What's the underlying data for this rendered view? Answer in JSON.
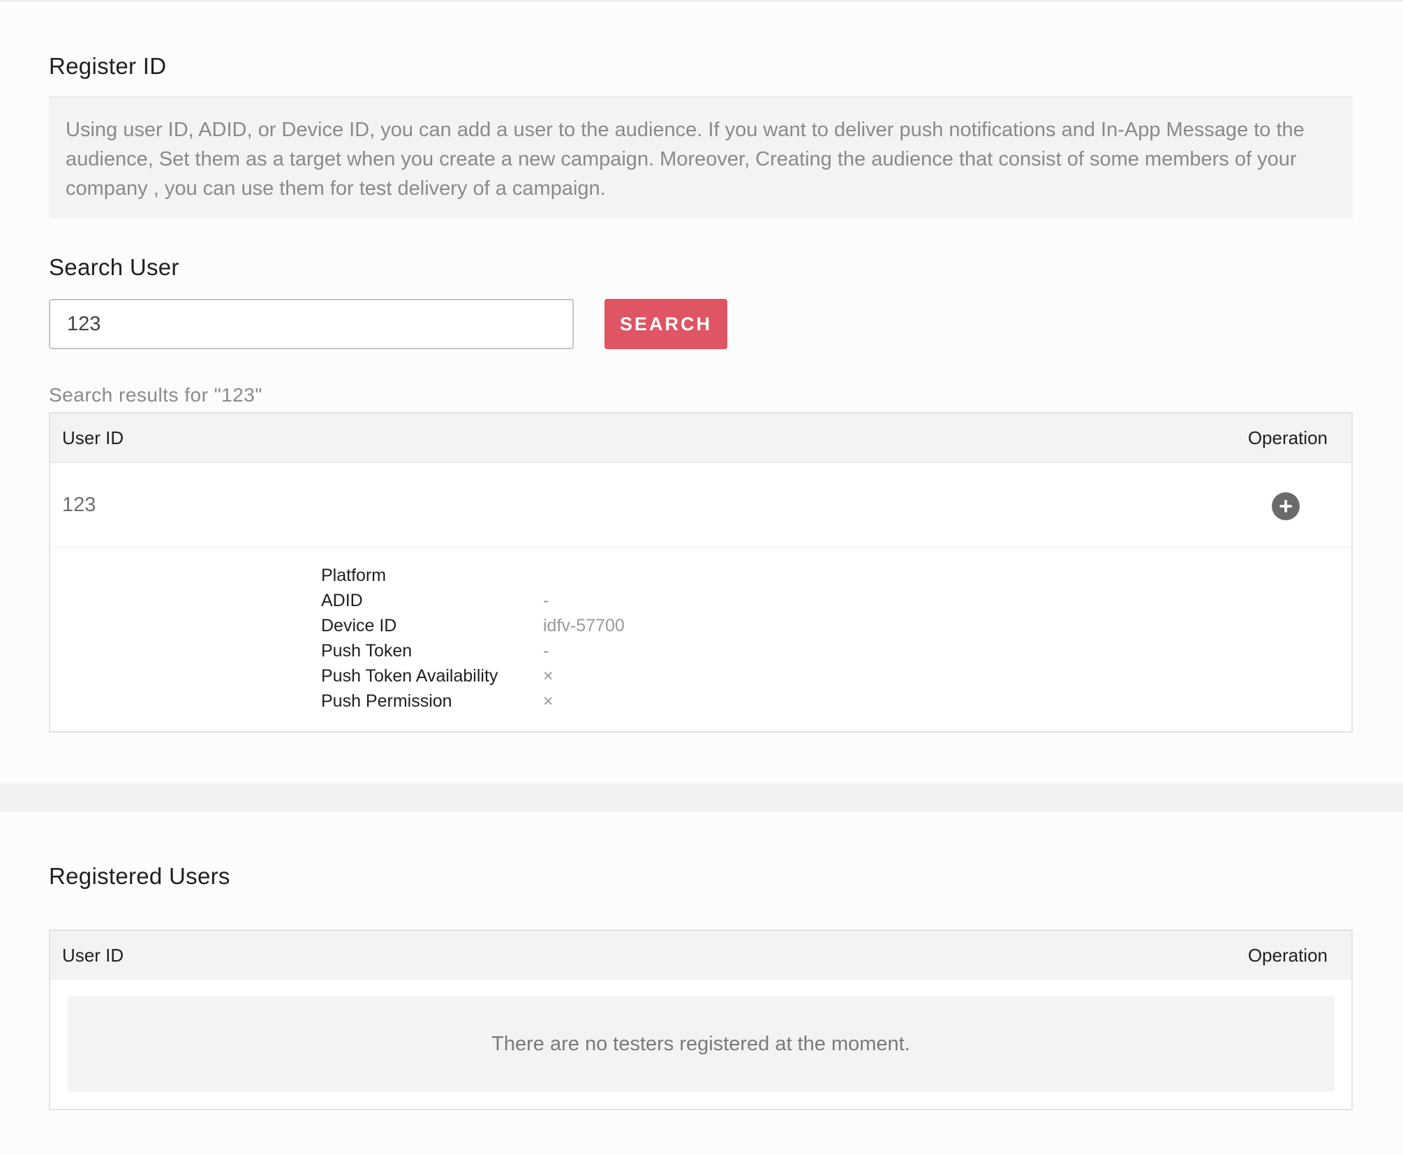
{
  "register": {
    "title": "Register ID",
    "description": "Using user ID, ADID, or Device ID, you can add a user to the audience. If you want to deliver push notifications and In-App Message to the audience, Set them as a target when you create a new campaign. Moreover, Creating the audience that consist of some members of your company , you can use them for test delivery of a campaign."
  },
  "search": {
    "title": "Search User",
    "value": "123",
    "button_label": "SEARCH",
    "results_caption": "Search results for \"123\""
  },
  "results_table": {
    "col_user_id": "User ID",
    "col_operation": "Operation",
    "rows": [
      {
        "user_id": "123",
        "add_icon": "plus-circle-icon",
        "details": [
          {
            "label": "Platform",
            "value": ""
          },
          {
            "label": "ADID",
            "value": "-"
          },
          {
            "label": "Device ID",
            "value": "idfv-57700"
          },
          {
            "label": "Push Token",
            "value": "-"
          },
          {
            "label": "Push Token Availability",
            "value": "×"
          },
          {
            "label": "Push Permission",
            "value": "×"
          }
        ]
      }
    ]
  },
  "registered": {
    "title": "Registered Users",
    "col_user_id": "User ID",
    "col_operation": "Operation",
    "empty_message": "There are no testers registered at the moment."
  },
  "colors": {
    "accent": "#e05563",
    "panel": "#f3f3f3",
    "icon": "#6a6a6a"
  }
}
